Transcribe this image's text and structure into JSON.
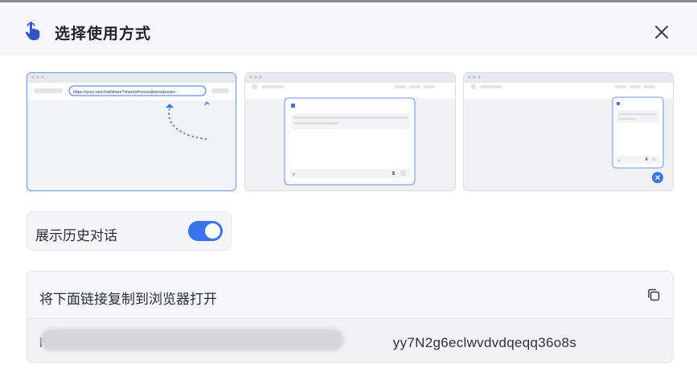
{
  "dialog": {
    "title": "选择使用方式",
    "icon": "pointer-hand-icon",
    "accent_color": "#3873f0"
  },
  "modes": [
    {
      "name": "full-page",
      "url_text": "https://xxxx.run/chat/share?shareId=xxxxx&xxxx&xxxxx",
      "selected": true
    },
    {
      "name": "iframe-embed",
      "selected": false
    },
    {
      "name": "floating-bubble",
      "selected": false
    }
  ],
  "options": {
    "show_history_label": "展示历史对话",
    "show_history_enabled": true
  },
  "link": {
    "title": "将下面链接复制到浏览器打开",
    "url_prefix": "h",
    "url_suffix": "yy7N2g6eclwvdvdqeqq36o8s"
  }
}
